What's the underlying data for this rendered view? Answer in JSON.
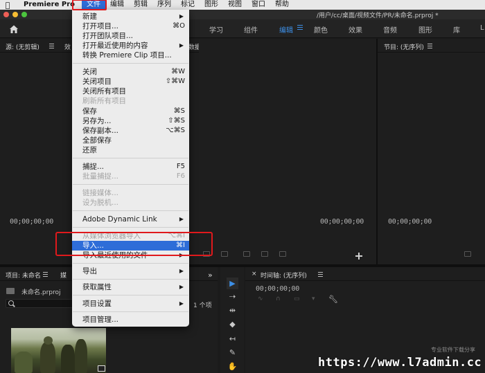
{
  "menubar": {
    "apple": "",
    "app_name": "Premiere Pro",
    "items": [
      "文件",
      "编辑",
      "剪辑",
      "序列",
      "标记",
      "图形",
      "视图",
      "窗口",
      "帮助"
    ]
  },
  "titlebar": {
    "path": "/用户/cc/桌面/视频文件/PR/未命名.prproj *"
  },
  "workspaces": {
    "tabs": [
      "学习",
      "组件",
      "编辑",
      "颜色",
      "效果",
      "音频",
      "图形",
      "库",
      "L"
    ],
    "active": "编辑"
  },
  "source_panel": {
    "title": "源: (无剪辑)",
    "extra_tab": "效",
    "timecode": "00;00;00;00",
    "partial_text": "数据"
  },
  "middle_panel": {
    "timecode": "00;00;00;00"
  },
  "program_panel": {
    "title": "节目: (无序列)",
    "timecode": "00;00;00;00"
  },
  "project_panel": {
    "title": "项目: 未命名",
    "extra_tab": "媒",
    "file": "未命名.prproj",
    "count": "1 个项",
    "more": "»"
  },
  "timeline_panel": {
    "title": "时间轴: (无序列)",
    "timecode": "00;00;00;00"
  },
  "file_menu": {
    "new": "新建",
    "open_project": "打开项目...",
    "open_project_sc": "⌘O",
    "open_team_project": "打开团队项目...",
    "open_recent": "打开最近使用的内容",
    "convert_clip": "转换 Premiere Clip 项目...",
    "close": "关闭",
    "close_sc": "⌘W",
    "close_project": "关闭项目",
    "close_project_sc": "⇧⌘W",
    "close_all": "关闭所有项目",
    "refresh_all": "刷新所有项目",
    "save": "保存",
    "save_sc": "⌘S",
    "save_as": "另存为...",
    "save_as_sc": "⇧⌘S",
    "save_copy": "保存副本...",
    "save_copy_sc": "⌥⌘S",
    "save_all": "全部保存",
    "revert": "还原",
    "capture": "捕捉...",
    "capture_sc": "F5",
    "batch_capture": "批量捕捉...",
    "batch_capture_sc": "F6",
    "link_media": "链接媒体...",
    "make_offline": "设为脱机...",
    "adobe_dynamic_link": "Adobe Dynamic Link",
    "import_from_browser": "从媒体浏览器导入",
    "import_from_browser_sc": "⌥⌘I",
    "import": "导入...",
    "import_sc": "⌘I",
    "import_recent": "导入最近使用的文件",
    "export": "导出",
    "get_properties": "获取属性",
    "project_settings": "项目设置",
    "project_manager": "项目管理..."
  },
  "watermark": {
    "main": "https://www.l7admin.cc",
    "sub": "专业软件下载分享"
  }
}
